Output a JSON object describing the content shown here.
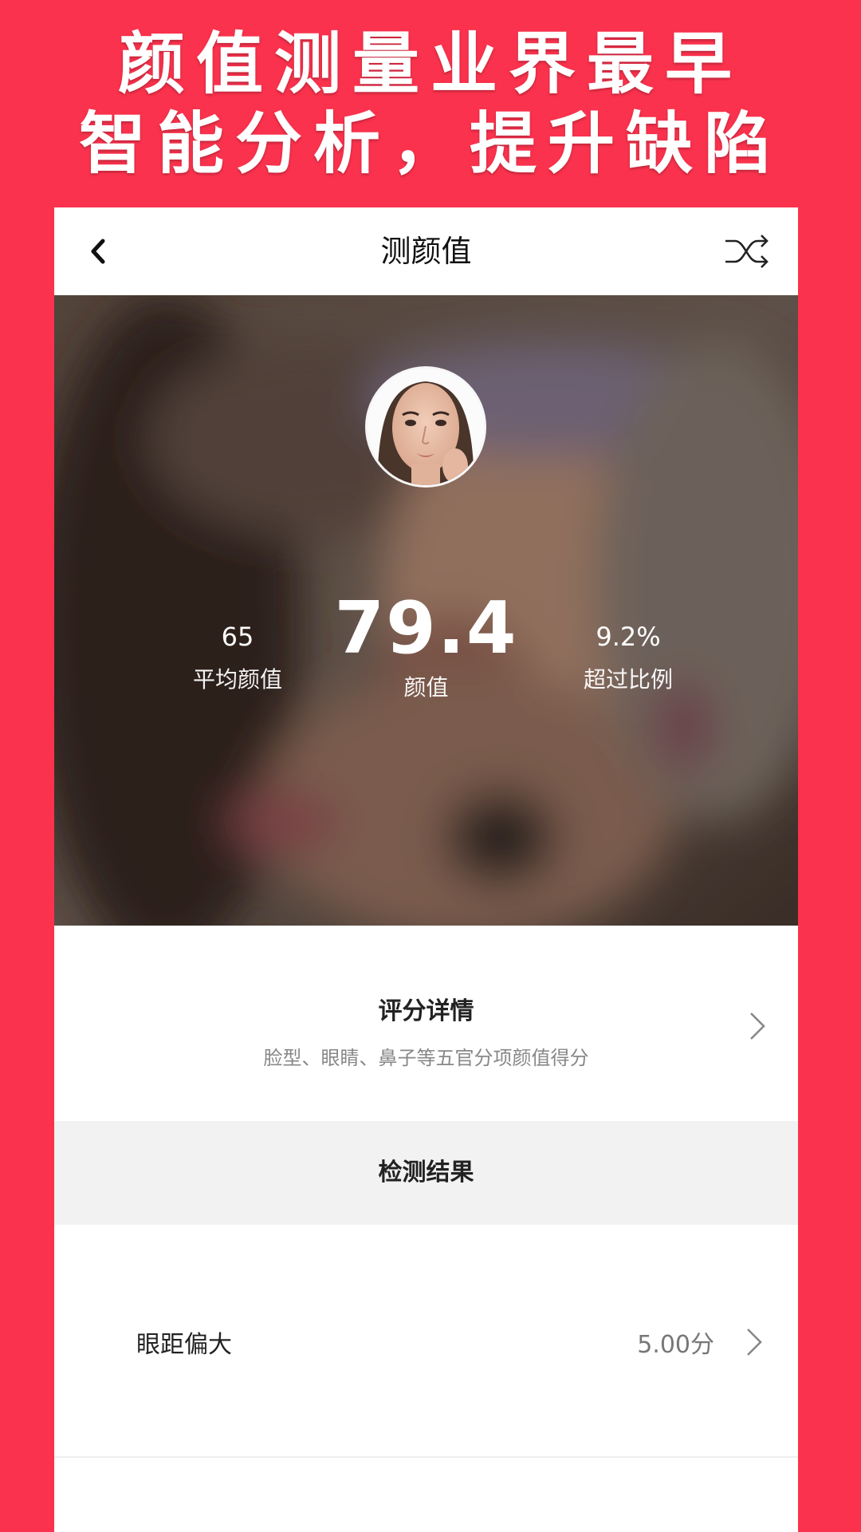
{
  "promo": {
    "line1": "颜值测量业界最早",
    "line2": "智能分析，提升缺陷"
  },
  "navbar": {
    "title": "测颜值",
    "back_icon": "chevron-left-icon",
    "shuffle_icon": "shuffle-icon"
  },
  "hero": {
    "average_value": "65",
    "average_label": "平均颜值",
    "score_value": "79.4",
    "score_label": "颜值",
    "percent_value": "9.2%",
    "percent_label": "超过比例"
  },
  "detail": {
    "title": "评分详情",
    "subtitle": "脸型、眼睛、鼻子等五官分项颜值得分"
  },
  "results": {
    "header": "检测结果",
    "items": [
      {
        "label": "眼距偏大",
        "score": "5.00分"
      }
    ]
  },
  "colors": {
    "brand_red": "#fb324d",
    "section_gray": "#f2f2f2"
  }
}
